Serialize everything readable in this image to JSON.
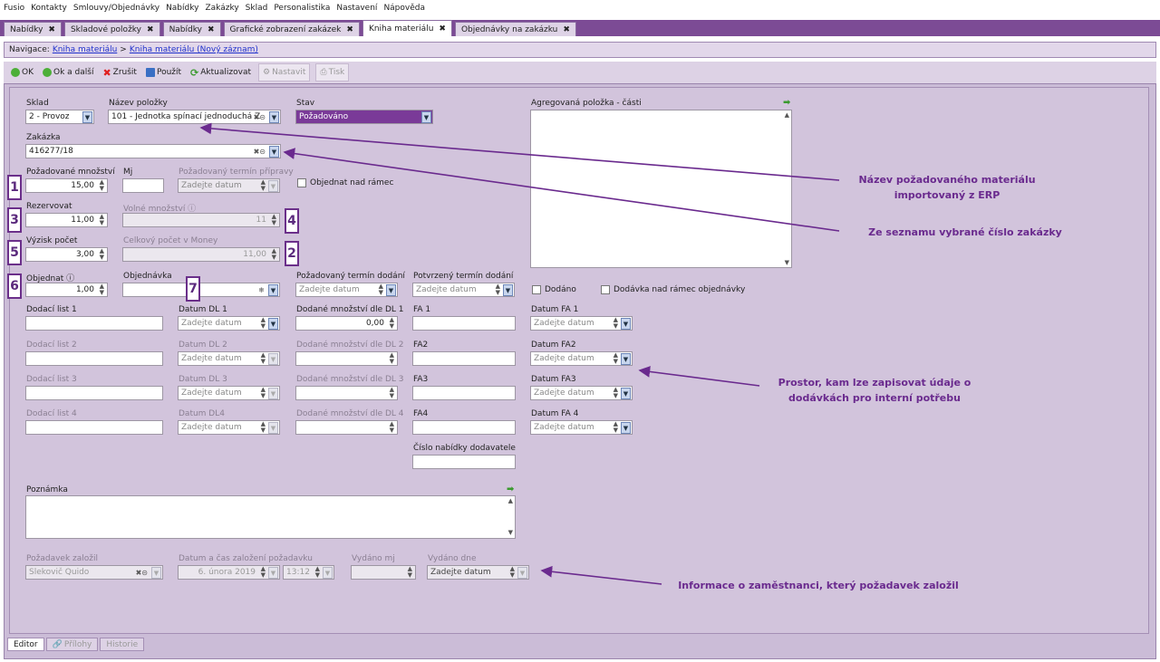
{
  "menu": [
    "Fusio",
    "Kontakty",
    "Smlouvy/Objednávky",
    "Nabídky",
    "Zakázky",
    "Sklad",
    "Personalistika",
    "Nastavení",
    "Nápověda"
  ],
  "tabs": [
    "Nabídky",
    "Skladové položky",
    "Nabídky",
    "Grafické zobrazení zakázek",
    "Kniha materiálu",
    "Objednávky na zakázku"
  ],
  "nav": {
    "prefix": "Navigace:",
    "link1": "Kniha materiálu",
    "sep": ">",
    "link2": "Kniha materiálu (Nový záznam)"
  },
  "toolbar": {
    "ok": "OK",
    "ok_next": "Ok a další",
    "cancel": "Zrušit",
    "use": "Použít",
    "refresh": "Aktualizovat",
    "set": "Nastavit",
    "print": "Tisk"
  },
  "form": {
    "sklad_label": "Sklad",
    "sklad_value": "2 - Provoz",
    "nazev_label": "Název položky",
    "nazev_value": "101 - Jednotka spínací jednoduchá Z",
    "stav_label": "Stav",
    "stav_value": "Požadováno",
    "agreg_label": "Agregovaná položka - části",
    "zakazka_label": "Zakázka",
    "zakazka_value": "416277/18",
    "pozmn_label": "Požadované množství",
    "pozmn_value": "15,00",
    "mj_label": "Mj",
    "termin_prip_label": "Požadovaný termín přípravy",
    "objednat_nad_label": "Objednat nad rámec",
    "rezervovat_label": "Rezervovat",
    "rezervovat_value": "11,00",
    "volne_label": "Volné množství ⓘ",
    "volne_value": "11",
    "vyzisk_label": "Výzisk počet",
    "vyzisk_value": "3,00",
    "celkovy_label": "Celkový počet v Money",
    "celkovy_value": "11,00",
    "objednat_label": "Objednat ⓘ",
    "objednat_value": "1,00",
    "objednavka_label": "Objednávka",
    "pozterm_label": "Požadovaný termín dodání",
    "potvterm_label": "Potvrzený termín dodání",
    "dodano_label": "Dodáno",
    "dodavka_nad_label": "Dodávka nad rámec objednávky",
    "dl1": "Dodací list 1",
    "datum_dl1": "Datum DL 1",
    "dod_mn1": "Dodané množství dle DL 1",
    "dod_mn1_value": "0,00",
    "fa1": "FA 1",
    "datum_fa1": "Datum FA 1",
    "dl2": "Dodací list 2",
    "datum_dl2": "Datum DL 2",
    "dod_mn2": "Dodané množství dle DL 2",
    "fa2": "FA2",
    "datum_fa2": "Datum FA2",
    "dl3": "Dodací list 3",
    "datum_dl3": "Datum DL 3",
    "dod_mn3": "Dodané množství dle DL 3",
    "fa3": "FA3",
    "datum_fa3": "Datum FA3",
    "dl4": "Dodací list 4",
    "datum_dl4": "Datum DL4",
    "dod_mn4": "Dodané množství dle DL 4",
    "fa4": "FA4",
    "datum_fa4": "Datum FA 4",
    "cislo_nab_label": "Číslo nabídky dodavatele",
    "poznamka_label": "Poznámka",
    "zalozil_label": "Požadavek založil",
    "zalozil_value": "Slekovič Quido",
    "datum_zal_label": "Datum a čas založení požadavku",
    "datum_zal_value": "6. února 2019",
    "cas_zal_value": "13:12",
    "vydano_mj_label": "Vydáno mj",
    "vydano_dne_label": "Vydáno dne",
    "date_placeholder": "Zadejte datum"
  },
  "annotations": {
    "n1": "1",
    "n2": "2",
    "n3": "3",
    "n4": "4",
    "n5": "5",
    "n6": "6",
    "n7": "7",
    "note1a": "Název požadovaného materiálu",
    "note1b": "importovaný z ERP",
    "note2": "Ze seznamu vybrané číslo zakázky",
    "note3a": "Prostor, kam lze zapisovat údaje o",
    "note3b": "dodávkách pro interní potřebu",
    "note4": "Informace o zaměstnanci, který požadavek založil"
  },
  "bottom_tabs": [
    "Editor",
    "Přílohy",
    "Historie"
  ],
  "colors": {
    "accent": "#7c4b95",
    "annotation": "#6a2a8e",
    "stav_bg": "#7a3a98"
  }
}
